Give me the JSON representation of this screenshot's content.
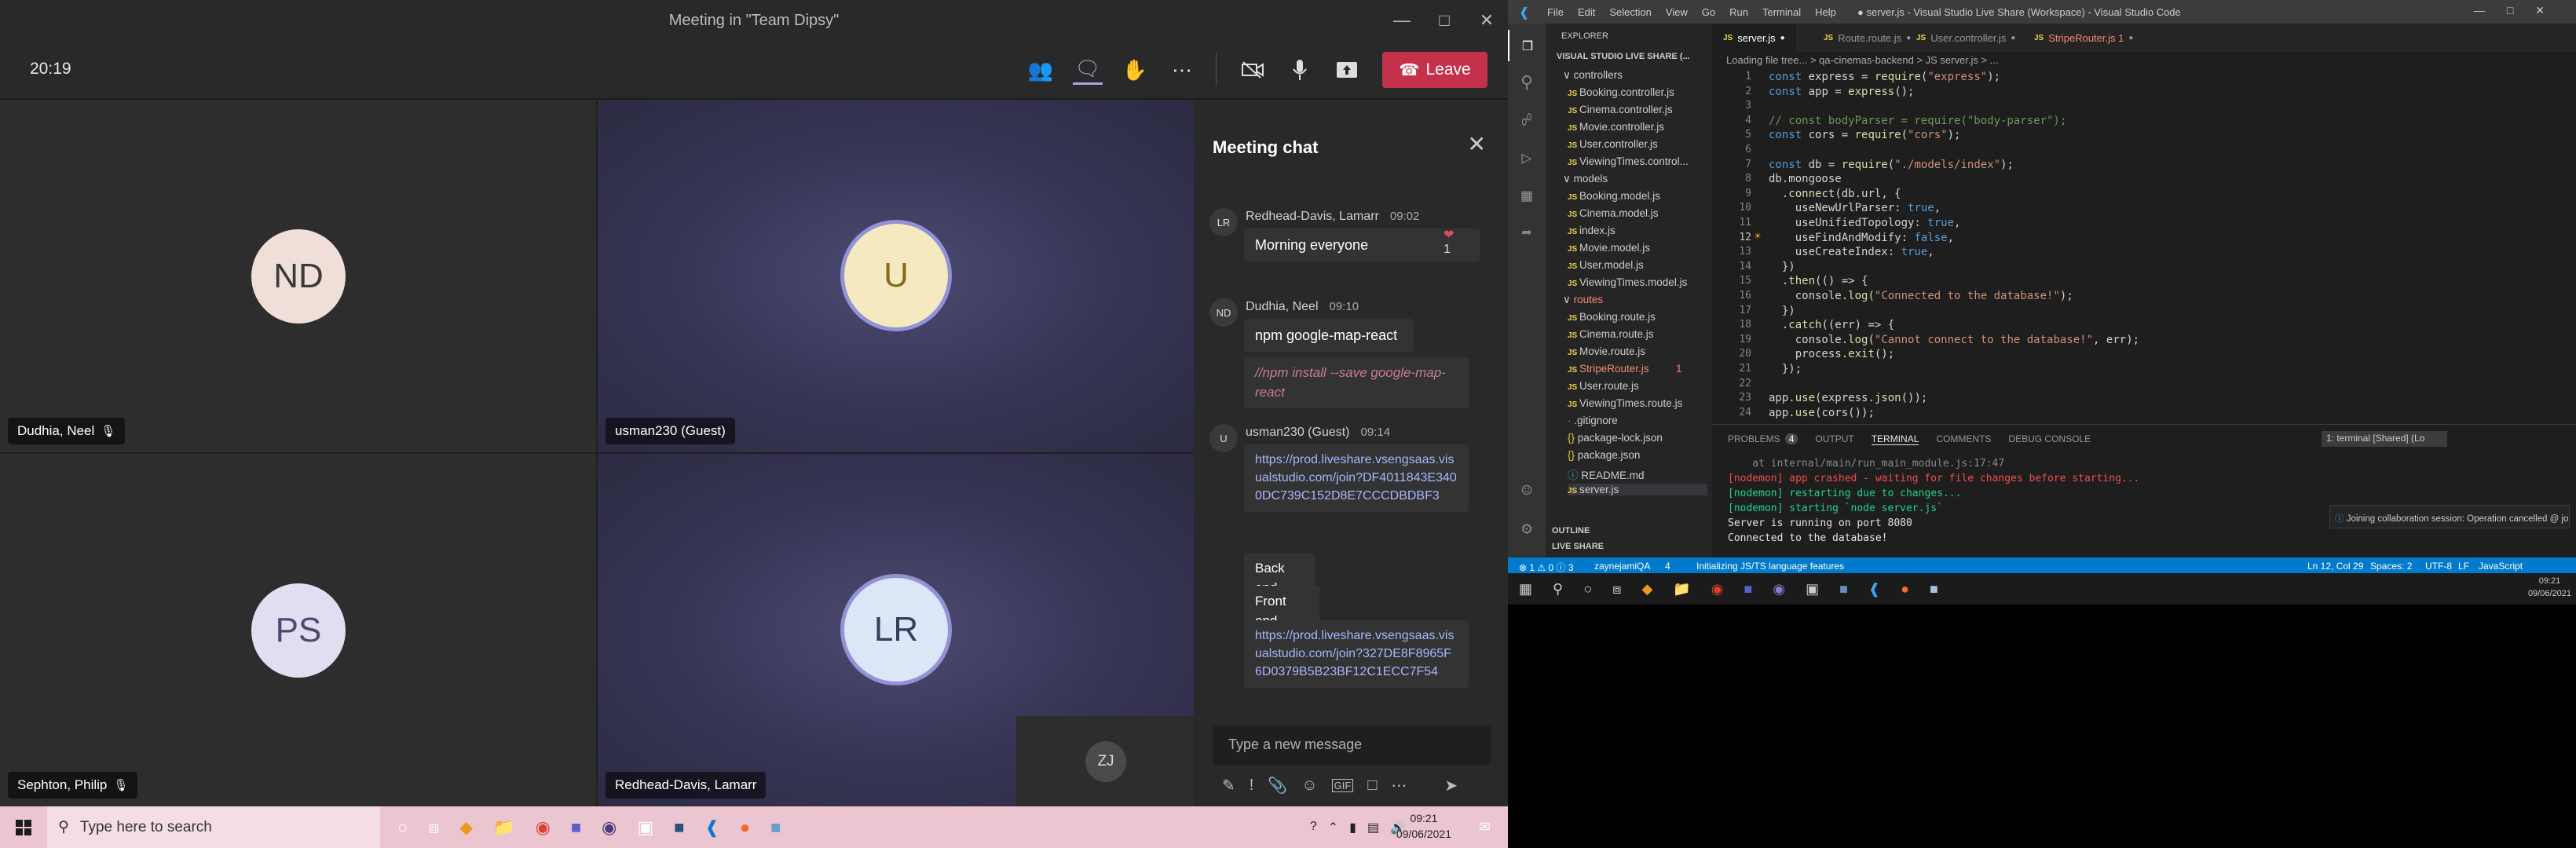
{
  "teams": {
    "window_title": "Meeting in \"Team Dipsy\"",
    "timer": "20:19",
    "leave_label": "Leave",
    "participants": [
      {
        "initials": "ND",
        "name": "Dudhia, Neel",
        "avatar_bg": "#efdfd8"
      },
      {
        "initials": "U",
        "name": "usman230 (Guest)",
        "avatar_bg": "#f5e9c0"
      },
      {
        "initials": "PS",
        "name": "Sephton, Philip",
        "avatar_bg": "#e3ddf2"
      },
      {
        "initials": "LR",
        "name": "Redhead-Davis, Lamarr",
        "avatar_bg": "#dbe6f7"
      },
      {
        "initials": "ZJ",
        "name": "",
        "avatar_bg": "#4a4a4a"
      }
    ],
    "chat": {
      "title": "Meeting chat",
      "messages": [
        {
          "avatar": "LR",
          "author": "Redhead-Davis, Lamarr",
          "time": "09:02",
          "text": "Morning everyone",
          "reaction_count": "1"
        },
        {
          "avatar": "ND",
          "author": "Dudhia, Neel",
          "time": "09:10",
          "text": "npm google-map-react",
          "text2": "//npm install --save google-map-react"
        },
        {
          "avatar": "U",
          "author": "usman230 (Guest)",
          "time": "09:14",
          "link1": "https://prod.liveshare.vsengsaas.visualstudio.com/join?DF4011843E3400DC739C152D8E7CCCDBDBF3",
          "text": "Back end",
          "text2": "Front end",
          "link2": "https://prod.liveshare.vsengsaas.visualstudio.com/join?327DE8F8965F6D0379B5B23BF12C1ECC7F54"
        }
      ],
      "compose_placeholder": "Type a new message"
    }
  },
  "taskbar": {
    "search_placeholder": "Type here to search",
    "time": "09:21",
    "date": "09/06/2021"
  },
  "vscode": {
    "window_title": "● server.js - Visual Studio Live Share (Workspace) - Visual Studio Code",
    "menu": [
      "File",
      "Edit",
      "Selection",
      "View",
      "Go",
      "Run",
      "Terminal",
      "Help"
    ],
    "explorer_title": "EXPLORER",
    "workspace_title": "VISUAL STUDIO LIVE SHARE (...",
    "files": [
      {
        "label": "controllers",
        "kind": "folder"
      },
      {
        "label": "Booking.controller.js",
        "kind": "js"
      },
      {
        "label": "Cinema.controller.js",
        "kind": "js"
      },
      {
        "label": "Movie.controller.js",
        "kind": "js"
      },
      {
        "label": "User.controller.js",
        "kind": "js"
      },
      {
        "label": "ViewingTimes.control...",
        "kind": "js"
      },
      {
        "label": "models",
        "kind": "folder"
      },
      {
        "label": "Booking.model.js",
        "kind": "js"
      },
      {
        "label": "Cinema.model.js",
        "kind": "js"
      },
      {
        "label": "index.js",
        "kind": "js"
      },
      {
        "label": "Movie.model.js",
        "kind": "js"
      },
      {
        "label": "User.model.js",
        "kind": "js"
      },
      {
        "label": "ViewingTimes.model.js",
        "kind": "js"
      },
      {
        "label": "routes",
        "kind": "folder-err"
      },
      {
        "label": "Booking.route.js",
        "kind": "js"
      },
      {
        "label": "Cinema.route.js",
        "kind": "js"
      },
      {
        "label": "Movie.route.js",
        "kind": "js"
      },
      {
        "label": "StripeRouter.js",
        "kind": "err"
      },
      {
        "label": "User.route.js",
        "kind": "js"
      },
      {
        "label": "ViewingTimes.route.js",
        "kind": "js"
      },
      {
        "label": ".gitignore",
        "kind": "plain"
      },
      {
        "label": "package-lock.json",
        "kind": "json"
      },
      {
        "label": "package.json",
        "kind": "json"
      },
      {
        "label": "README.md",
        "kind": "md"
      },
      {
        "label": "server.js",
        "kind": "js"
      }
    ],
    "stripe_err_count": "1",
    "outline_label": "OUTLINE",
    "liveshare_label": "LIVE SHARE",
    "tabs": [
      {
        "label": "server.js",
        "active": true
      },
      {
        "label": "Route.route.js",
        "active": false
      },
      {
        "label": "User.controller.js",
        "active": false
      },
      {
        "label": "StripeRouter.js 1",
        "active": false
      }
    ],
    "breadcrumbs": "Loading file tree...  >  qa-cinemas-backend  >  JS server.js  >  ...",
    "code_lines": [
      "const express = require(\"express\");",
      "const app = express();",
      "",
      "// const bodyParser = require(\"body-parser\");",
      "const cors = require(\"cors\");",
      "",
      "const db = require(\"./models/index\");",
      "db.mongoose",
      "  .connect(db.url, {",
      "    useNewUrlParser: true,",
      "    useUnifiedTopology: true,",
      "    useFindAndModify: false,",
      "    useCreateIndex: true,",
      "  })",
      "  .then(() => {",
      "    console.log(\"Connected to the database!\");",
      "  })",
      "  .catch((err) => {",
      "    console.log(\"Cannot connect to the database!\", err);",
      "    process.exit();",
      "  });",
      "",
      "app.use(express.json());",
      "app.use(cors());"
    ],
    "panel_tabs": [
      "PROBLEMS",
      "OUTPUT",
      "TERMINAL",
      "COMMENTS",
      "DEBUG CONSOLE"
    ],
    "problems_count": "4",
    "terminal_select": "1: terminal [Shared] (Lo",
    "terminal_lines": [
      "    at internal/main/run_main_module.js:17:47",
      "[nodemon] app crashed - waiting for file changes before starting...",
      "[nodemon] restarting due to changes...",
      "[nodemon] starting `node server.js`",
      "Server is running on port 8080",
      "Connected to the database!"
    ],
    "notification": "Joining collaboration session: Operation cancelled @ join collaboratio...",
    "status_left": "⊗ 1 ⚠ 0 ⓘ 3",
    "status_user": "zaynejamiQA",
    "status_ports": "4",
    "status_init": "Initializing JS/TS language features",
    "status_pos": "Ln 12, Col 29",
    "status_spaces": "Spaces: 2",
    "status_enc": "UTF-8",
    "status_eol": "LF",
    "status_lang": "JavaScript",
    "taskbar_time": "09:21",
    "taskbar_date": "09/06/2021"
  }
}
